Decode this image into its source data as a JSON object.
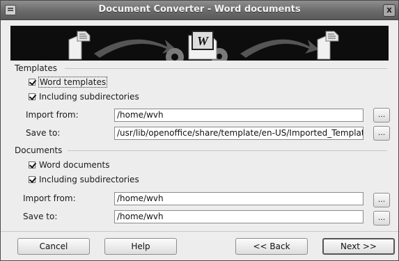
{
  "window": {
    "title": "Document Converter - Word documents",
    "close_glyph": "x"
  },
  "templates": {
    "group_label": "Templates",
    "word_templates": {
      "label": "Word templates",
      "checked": true
    },
    "include_subdirs": {
      "label": "Including subdirectories",
      "checked": true
    },
    "import_label": "Import from:",
    "import_value": "/home/wvh",
    "save_label": "Save to:",
    "save_value": "/usr/lib/openoffice/share/template/en-US/Imported_Templates",
    "browse_label": "..."
  },
  "documents": {
    "group_label": "Documents",
    "word_documents": {
      "label": "Word documents",
      "checked": true
    },
    "include_subdirs": {
      "label": "Including subdirectories",
      "checked": true
    },
    "import_label": "Import from:",
    "import_value": "/home/wvh",
    "save_label": "Save to:",
    "save_value": "/home/wvh",
    "browse_label": "..."
  },
  "buttons": {
    "cancel": "Cancel",
    "help": "Help",
    "back": "<< Back",
    "next": "Next >>"
  },
  "icons": [
    "menu-icon",
    "close-icon",
    "document-icon",
    "word-document-icon",
    "arrow-icon",
    "gear-icon"
  ]
}
